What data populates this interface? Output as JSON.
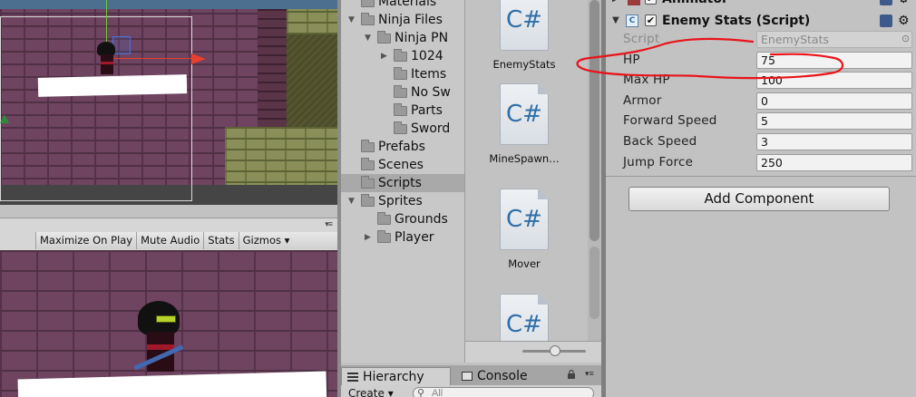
{
  "game_toolbar": {
    "buttons": [
      "Maximize On Play",
      "Mute Audio",
      "Stats",
      "Gizmos ▾"
    ]
  },
  "project": {
    "tree": [
      {
        "label": "Materials",
        "indent": 0,
        "arrow": "",
        "selected": false
      },
      {
        "label": "Ninja Files",
        "indent": 0,
        "arrow": "▼",
        "selected": false
      },
      {
        "label": "Ninja PN",
        "indent": 1,
        "arrow": "▼",
        "selected": false
      },
      {
        "label": "1024",
        "indent": 2,
        "arrow": "▶",
        "selected": false
      },
      {
        "label": "Items",
        "indent": 2,
        "arrow": "",
        "selected": false
      },
      {
        "label": "No Sw",
        "indent": 2,
        "arrow": "",
        "selected": false
      },
      {
        "label": "Parts",
        "indent": 2,
        "arrow": "",
        "selected": false
      },
      {
        "label": "Sword",
        "indent": 2,
        "arrow": "",
        "selected": false
      },
      {
        "label": "Prefabs",
        "indent": 0,
        "arrow": "",
        "selected": false
      },
      {
        "label": "Scenes",
        "indent": 0,
        "arrow": "",
        "selected": false
      },
      {
        "label": "Scripts",
        "indent": 0,
        "arrow": "",
        "selected": true
      },
      {
        "label": "Sprites",
        "indent": 0,
        "arrow": "▼",
        "selected": false
      },
      {
        "label": "Grounds",
        "indent": 1,
        "arrow": "",
        "selected": false
      },
      {
        "label": "Player",
        "indent": 1,
        "arrow": "▶",
        "selected": false
      }
    ],
    "assets": [
      {
        "name": "EnemyStats",
        "glyph": "C#"
      },
      {
        "name": "MineSpawn…",
        "glyph": "C#"
      },
      {
        "name": "Mover",
        "glyph": "C#"
      },
      {
        "name": "",
        "glyph": "C#"
      }
    ]
  },
  "bottom_tabs": {
    "hierarchy": "Hierarchy",
    "console": "Console",
    "create": "Create ▾",
    "search_placeholder": "All"
  },
  "inspector": {
    "animator_title": "Animator",
    "component_title": "Enemy Stats (Script)",
    "component_enabled": true,
    "fields": [
      {
        "label": "Script",
        "value": "EnemyStats",
        "disabled": true
      },
      {
        "label": "HP",
        "value": "75",
        "disabled": false
      },
      {
        "label": "Max HP",
        "value": "100",
        "disabled": false
      },
      {
        "label": "Armor",
        "value": "0",
        "disabled": false
      },
      {
        "label": "Forward Speed",
        "value": "5",
        "disabled": false
      },
      {
        "label": "Back Speed",
        "value": "3",
        "disabled": false
      },
      {
        "label": "Jump Force",
        "value": "250",
        "disabled": false
      }
    ],
    "add_component": "Add Component"
  },
  "colors": {
    "annotation_red": "#e8141a",
    "cs_blue": "#2f6fa8",
    "selected_row": "#a9a9a9"
  }
}
